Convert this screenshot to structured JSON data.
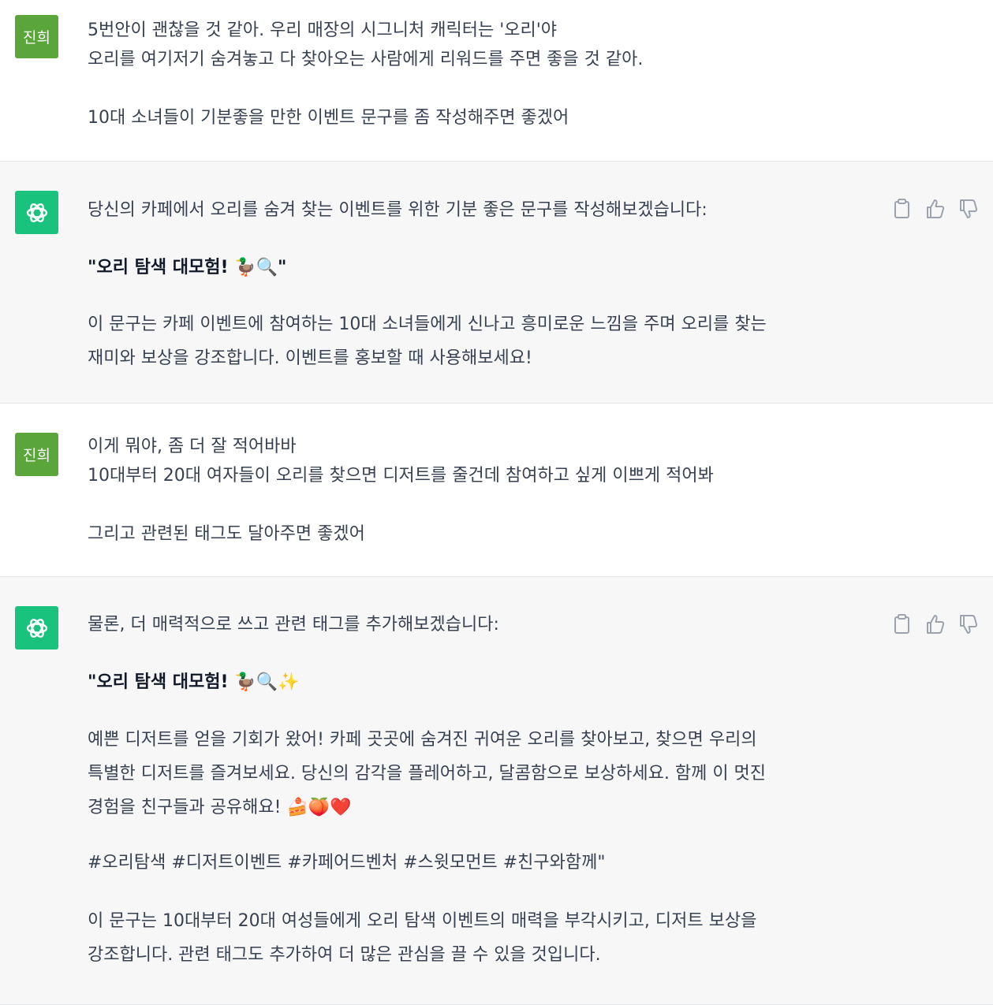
{
  "conversation": {
    "user_avatar_label": "진희",
    "messages": [
      {
        "role": "user",
        "lines": [
          "5번안이 괜찮을 것 같아. 우리 매장의 시그니처 캐릭터는 '오리'야",
          "오리를 여기저기 숨겨놓고 다 찾아오는 사람에게 리워드를 주면 좋을 것 같아.",
          "",
          "10대 소녀들이 기분좋을 만한 이벤트 문구를 좀 작성해주면 좋겠어"
        ]
      },
      {
        "role": "assistant",
        "intro": "당신의 카페에서 오리를 숨겨 찾는 이벤트를 위한 기분 좋은 문구를 작성해보겠습니다:",
        "headline": "\"오리 탐색 대모험! 🦆🔍\"",
        "body_lines": [
          "이 문구는 카페 이벤트에 참여하는 10대 소녀들에게 신나고 흥미로운 느낌을 주며 오리를 찾는",
          "재미와 보상을 강조합니다. 이벤트를 홍보할 때 사용해보세요!"
        ]
      },
      {
        "role": "user",
        "lines": [
          "이게 뭐야, 좀 더 잘 적어바바",
          "10대부터 20대 여자들이 오리를 찾으면 디저트를 줄건데 참여하고 싶게 이쁘게 적어봐",
          "",
          "그리고 관련된 태그도 달아주면 좋겠어"
        ]
      },
      {
        "role": "assistant",
        "intro": "물론, 더 매력적으로 쓰고 관련 태그를 추가해보겠습니다:",
        "headline": "\"오리 탐색 대모험! 🦆🔍✨",
        "body_lines": [
          "예쁜 디저트를 얻을 기회가 왔어! 카페 곳곳에 숨겨진 귀여운 오리를 찾아보고, 찾으면 우리의",
          "특별한 디저트를 즐겨보세요. 당신의 감각을 플레어하고, 달콤함으로 보상하세요. 함께 이 멋진",
          "경험을 친구들과 공유해요! 🍰🍑❤️"
        ],
        "tags": "#오리탐색 #디저트이벤트 #카페어드벤처 #스윗모먼트 #친구와함께\"",
        "outro_lines": [
          "이 문구는 10대부터 20대 여성들에게 오리 탐색 이벤트의 매력을 부각시키고, 디저트 보상을",
          "강조합니다. 관련 태그도 추가하여 더 많은 관심을 끌 수 있을 것입니다."
        ]
      }
    ]
  },
  "colors": {
    "user_avatar": "#5aa63a",
    "assistant_avatar": "#19c37d",
    "assistant_background": "#f7f7f8",
    "text": "#374151",
    "icon": "#9ca3af"
  },
  "icons": {
    "assistant_avatar": "openai-logo-icon",
    "actions": [
      "copy-icon",
      "thumbs-up-icon",
      "thumbs-down-icon"
    ]
  }
}
